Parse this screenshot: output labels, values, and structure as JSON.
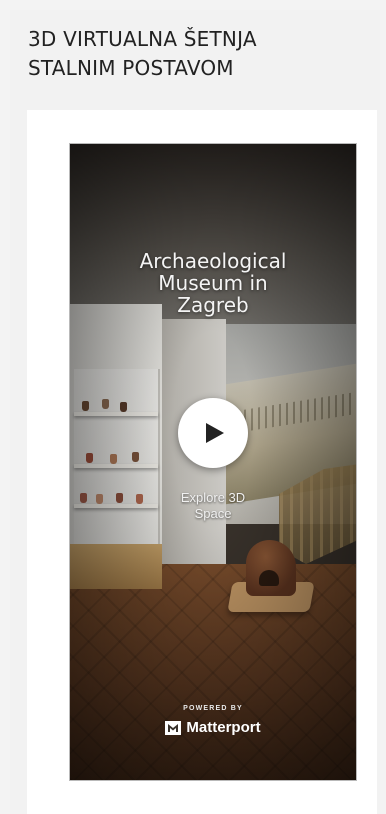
{
  "widget": {
    "title": "3D VIRTUALNA ŠETNJA\nSTALNIM POSTAVOM"
  },
  "viewer": {
    "model_title": "Archaeological\nMuseum in\nZagreb",
    "play_label": "Play",
    "explore_label": "Explore 3D\nSpace",
    "powered_by": "POWERED BY",
    "brand": "Matterport",
    "icons": {
      "play": "play-icon",
      "brand": "matterport-logo-icon"
    },
    "colors": {
      "play_button_bg": "#ffffff",
      "text": "#f4f4f4"
    }
  }
}
